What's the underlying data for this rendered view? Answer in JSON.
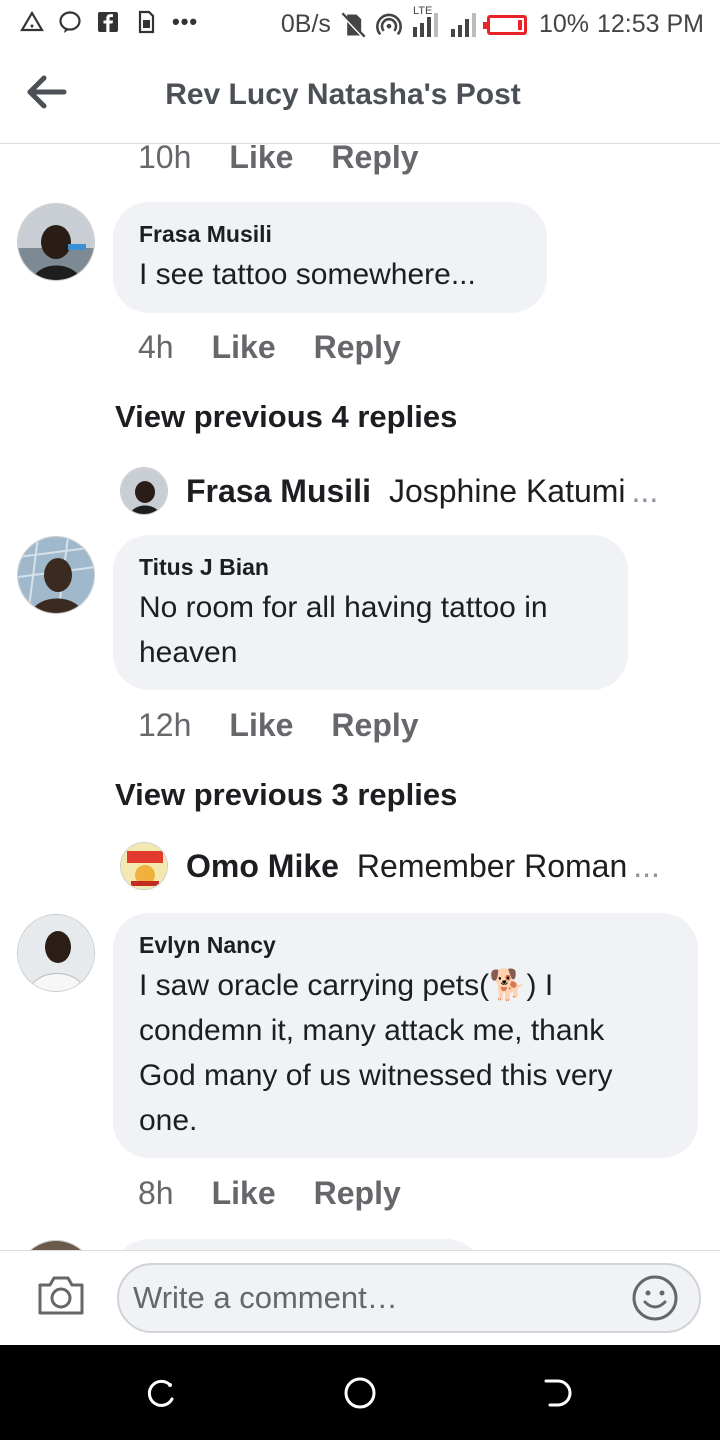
{
  "status_bar": {
    "speed": "0B/s",
    "network": "LTE",
    "battery": "10%",
    "time": "12:53 PM",
    "icons": [
      "warning-icon",
      "messenger-icon",
      "facebook-icon",
      "sim-icon",
      "more-dots-icon",
      "no-sim-icon",
      "hotspot-icon",
      "signal-icon",
      "battery-icon"
    ],
    "battery_color": "#e8232a"
  },
  "header": {
    "title": "Rev Lucy Natasha's Post",
    "back_icon": "arrow-left-icon"
  },
  "top_meta": {
    "time": "10h",
    "like": "Like",
    "reply": "Reply"
  },
  "comments": [
    {
      "author": "Frasa Musili",
      "text": "I see tattoo somewhere...",
      "time": "4h",
      "like": "Like",
      "reply": "Reply",
      "view_previous": "View previous 4 replies",
      "reply_preview": {
        "name": "Frasa Musili",
        "text": "Josphine Katumi",
        "more": "..."
      }
    },
    {
      "author": "Titus J Bian",
      "text_line1": "No room for all having tattoo in",
      "text_line2": "heaven",
      "time": "12h",
      "like": "Like",
      "reply": "Reply",
      "view_previous": "View previous 3 replies",
      "reply_preview": {
        "name": "Omo Mike",
        "text": "Remember Roman",
        "more": "..."
      }
    },
    {
      "author": "Evlyn Nancy",
      "text_line1a": "I saw oracle carrying pets(",
      "text_line1b": ") I",
      "text_line2": "condemn it, many attack me, thank",
      "text_line3": "God many of us witnessed this very",
      "text_line4": "one.",
      "emoji": "🐕",
      "time": "8h",
      "like": "Like",
      "reply": "Reply"
    }
  ],
  "composer": {
    "placeholder": "Write a comment…",
    "camera_icon": "camera-icon",
    "emoji_icon": "smiley-icon"
  },
  "colors": {
    "bubble": "#f0f2f5",
    "meta_text": "#65676b",
    "title_text": "#4b4f56"
  }
}
